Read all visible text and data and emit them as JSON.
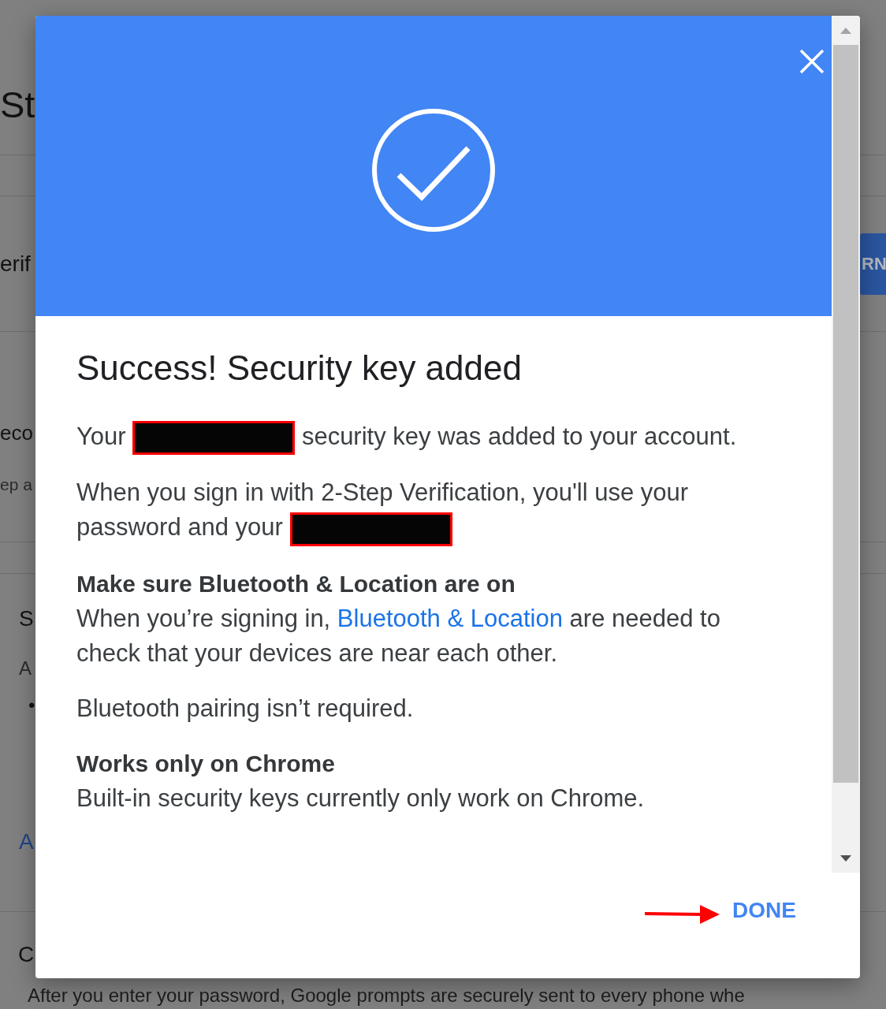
{
  "background_page": {
    "heading": "St",
    "setting_row": {
      "label": "erif",
      "button": "RN"
    },
    "security_row": {
      "title": "eco",
      "description": "ep a"
    },
    "section": {
      "heading": "S",
      "description": "A",
      "bullet": "•",
      "link": "A"
    },
    "last_section": {
      "heading": "C",
      "description": "After you enter your password, Google prompts are securely sent to every phone whe"
    }
  },
  "dialog": {
    "title": "Success! Security key added",
    "paragraphs": [
      {
        "kind": "parts",
        "parts": [
          {
            "kind": "text",
            "text": "Your"
          },
          {
            "kind": "redaction"
          },
          {
            "kind": "text",
            "text": "security key was added to your account."
          }
        ]
      },
      {
        "kind": "parts",
        "parts": [
          {
            "kind": "text",
            "text": "When you sign in with 2-Step Verification, you'll use your"
          },
          {
            "kind": "text",
            "text": "password and your"
          },
          {
            "kind": "redaction"
          }
        ]
      },
      {
        "kind": "heading",
        "text": "Make sure Bluetooth & Location are on"
      },
      {
        "kind": "link_text",
        "before": "When you’re signing in,",
        "link": "Bluetooth & Location",
        "after": "are needed to check that your devices are near each other."
      },
      {
        "kind": "text",
        "text": "Bluetooth pairing isn’t required."
      },
      {
        "kind": "heading",
        "text": "Works only on Chrome"
      },
      {
        "kind": "text",
        "text": "Built-in security keys currently only work on Chrome."
      }
    ],
    "done_button": "DONE"
  }
}
